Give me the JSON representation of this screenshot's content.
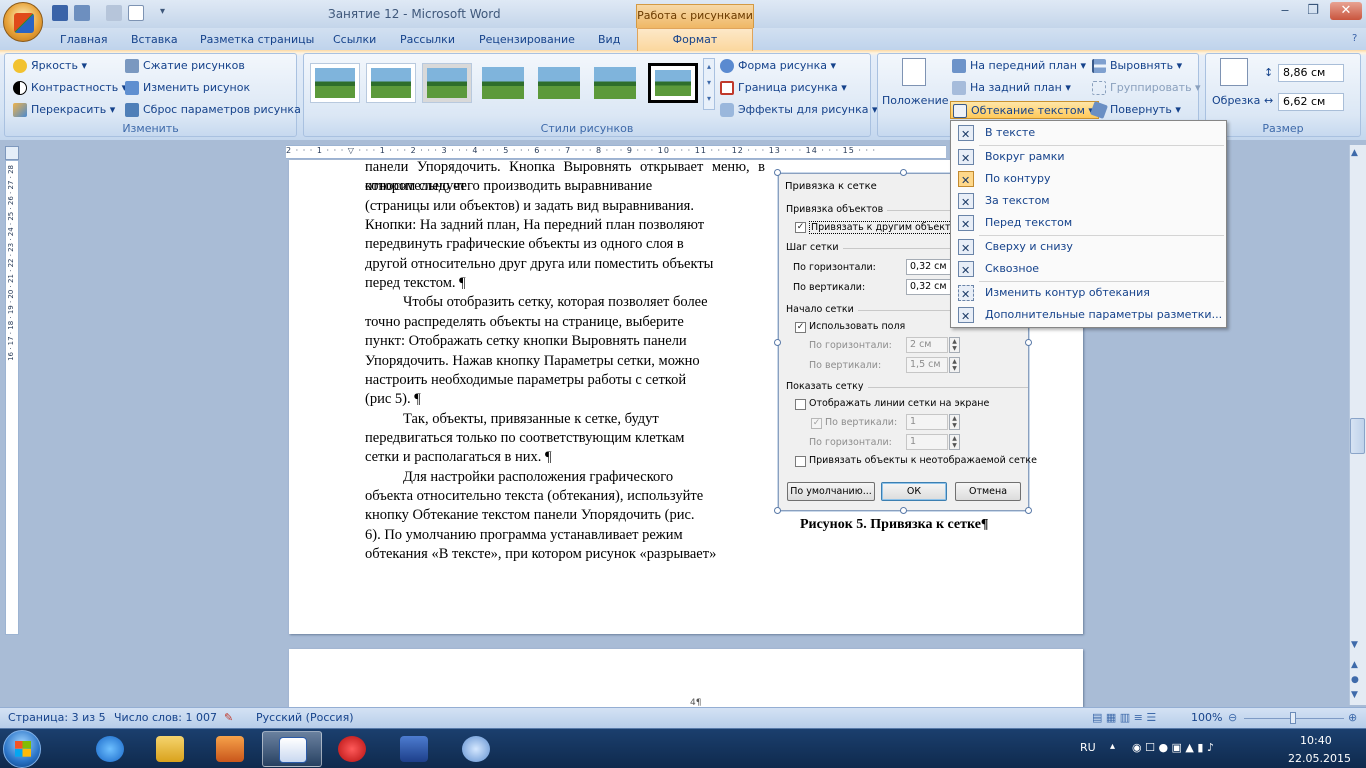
{
  "window": {
    "title": "Занятие 12 - Microsoft Word",
    "context_tab_title": "Работа с рисунками",
    "minimize": "‒",
    "maximize": "❐",
    "close": "✕"
  },
  "tabs": [
    "Главная",
    "Вставка",
    "Разметка страницы",
    "Ссылки",
    "Рассылки",
    "Рецензирование",
    "Вид",
    "Формат"
  ],
  "ribbon": {
    "adjust": {
      "label": "Изменить",
      "brightness": "Яркость",
      "contrast": "Контрастность",
      "recolor": "Перекрасить",
      "compress": "Сжатие рисунков",
      "change_picture": "Изменить рисунок",
      "reset_picture": "Сброс параметров рисунка"
    },
    "styles": {
      "label": "Стили рисунков",
      "shape": "Форма рисунка",
      "border": "Граница рисунка",
      "effects": "Эффекты для рисунка"
    },
    "arrange": {
      "position": "Положение",
      "bring_front": "На передний план",
      "send_back": "На задний план",
      "text_wrap": "Обтекание текстом",
      "align": "Выровнять",
      "group": "Группировать",
      "rotate": "Повернуть"
    },
    "size": {
      "label": "Размер",
      "crop": "Обрезка",
      "height": "8,86 см",
      "width": "6,62 см"
    }
  },
  "ruler": {
    "marks": "2 · · · 1 · · · ▽ · · · 1 · · · 2 · · · 3 · · · 4 · · · 5 · · · 6 · · · 7 · · · 8 · · · 9 · · · 10 · · · 11 · · · 12 · · · 13 · · · 14 · · · 15 · · ·",
    "vertical": "16 · 17 · 18 · 19 · 20 · 21 · 22 · 23 · 24 · 25 · 26 · 27 · 28"
  },
  "document": {
    "lines": [
      {
        "html": false,
        "text": "панели Упорядочить. Кнопка Выровнять открывает меню, в котором следует"
      },
      {
        "html": false,
        "text": "относительно чего производить выравнивание"
      },
      {
        "html": false,
        "text": "(страницы или объектов) и задать вид выравнивания."
      },
      {
        "html": false,
        "text": "Кнопки: На задний план, На передний план позволяют"
      },
      {
        "html": false,
        "text": "передвинуть графические объекты из одного слоя в"
      },
      {
        "html": false,
        "text": "другой относительно друг друга или поместить объекты"
      },
      {
        "html": false,
        "text": "перед текстом. ¶"
      },
      {
        "html": false,
        "text": "Чтобы отобразить сетку, которая позволяет более"
      },
      {
        "html": false,
        "text": "точно распределять объекты на странице, выберите"
      },
      {
        "html": false,
        "text": "пункт: Отображать сетку кнопки Выровнять панели"
      },
      {
        "html": false,
        "text": "Упорядочить. Нажав кнопку Параметры сетки, можно"
      },
      {
        "html": false,
        "text": "настроить необходимые параметры работы с сеткой"
      },
      {
        "html": false,
        "text": "(рис 5). ¶"
      },
      {
        "html": false,
        "text": "Так, объекты, привязанные к сетке, будут"
      },
      {
        "html": false,
        "text": "передвигаться только по соответствующим клеткам"
      },
      {
        "html": false,
        "text": "сетки и располагаться в них. ¶"
      },
      {
        "html": false,
        "text": "Для настройки расположения графического"
      },
      {
        "html": false,
        "text": "объекта относительно текста (обтекания), используйте"
      },
      {
        "html": false,
        "text": "кнопку Обтекание текстом панели Упорядочить (рис."
      },
      {
        "html": false,
        "text": "6). По умолчанию программа устанавливает режим"
      },
      {
        "html": false,
        "text": "обтекания «В тексте», при котором рисунок «разрывает»"
      }
    ],
    "caption": "Рисунок 5. Привязка к сетке¶",
    "page_number": "4¶"
  },
  "dialog": {
    "title": "Привязка к сетке",
    "snap_section": "Привязка объектов",
    "snap_other": "Привязать к другим объектам",
    "grid_step": "Шаг сетки",
    "horiz": "По горизонтали:",
    "vert": "По вертикали:",
    "horiz_val": "0,32 см",
    "vert_val": "0,32 см",
    "origin": "Начало сетки",
    "use_margins": "Использовать поля",
    "origin_h": "По горизонтали:",
    "origin_v": "По вертикали:",
    "origin_h_val": "2 см",
    "origin_v_val": "1,5 см",
    "show_grid": "Показать сетку",
    "show_lines": "Отображать линии сетки на экране",
    "show_v": "По вертикали:",
    "show_h": "По горизонтали:",
    "show_v_val": "1",
    "show_h_val": "1",
    "snap_hidden": "Привязать объекты к неотображаемой сетке",
    "default_btn": "По умолчанию...",
    "ok_btn": "ОК",
    "cancel_btn": "Отмена"
  },
  "wrap_menu": {
    "items": [
      "В тексте",
      "Вокруг рамки",
      "По контуру",
      "За текстом",
      "Перед текстом",
      "Сверху и снизу",
      "Сквозное",
      "Изменить контур обтекания",
      "Дополнительные параметры разметки..."
    ]
  },
  "status": {
    "page": "Страница: 3 из 5",
    "words": "Число слов: 1 007",
    "lang": "Русский (Россия)",
    "zoom": "100%"
  },
  "tray": {
    "lang": "RU",
    "time": "10:40",
    "date": "22.05.2015"
  },
  "colors": {
    "accent": "#15428b",
    "context_tab": "#fbd79d",
    "selected_item": "#ffd88a"
  }
}
